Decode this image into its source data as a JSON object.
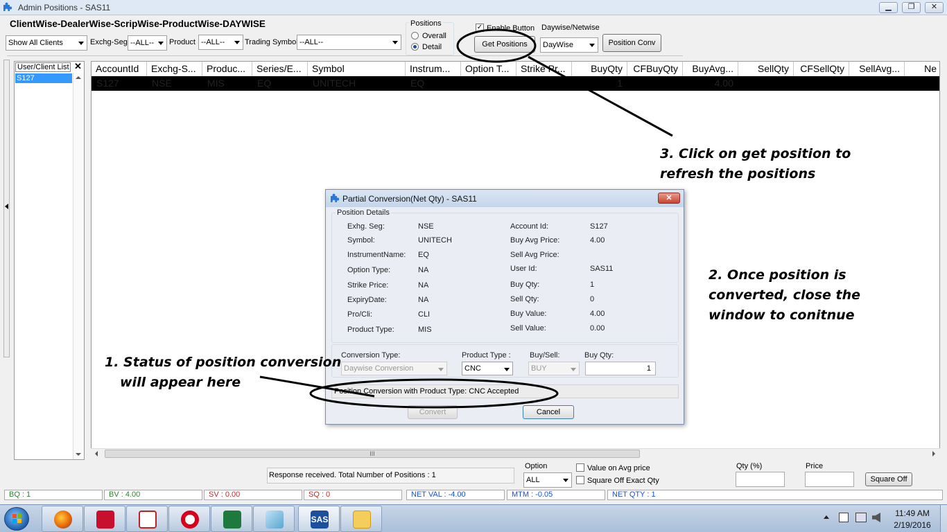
{
  "window": {
    "title": "Admin Positions - SAS11"
  },
  "heading": "ClientWise-DealerWise-ScripWise-ProductWise-DAYWISE",
  "filters": {
    "clients_value": "Show All Clients",
    "exchg_seg_label": "Exchg-Seg",
    "exchg_seg_value": "--ALL--",
    "product_label": "Product",
    "product_value": "--ALL--",
    "trading_symbol_label": "Trading Symbol",
    "trading_symbol_value": "--ALL--"
  },
  "positions_group": {
    "label": "Positions",
    "overall": "Overall",
    "detail": "Detail",
    "selected": "Detail"
  },
  "enable_button_label": "Enable Button",
  "get_positions_label": "Get Positions",
  "daywise_netwise": {
    "label": "Daywise/Netwise",
    "value": "DayWise"
  },
  "position_conv_label": "Position Conv",
  "user_list": {
    "header": "User/Client List",
    "items": [
      "S127"
    ]
  },
  "grid": {
    "columns": [
      "AccountId",
      "Exchg-S...",
      "Produc...",
      "Series/E...",
      "Symbol",
      "Instrum...",
      "Option T...",
      "Strike Pr...",
      "BuyQty",
      "CFBuyQty",
      "BuyAvg...",
      "SellQty",
      "CFSellQty",
      "SellAvg...",
      "Ne"
    ],
    "rows": [
      [
        "S127",
        "NSE",
        "MIS",
        "EQ",
        "UNITECH",
        "EQ",
        "",
        "",
        "1",
        "",
        "4.00",
        "",
        "",
        "",
        ""
      ]
    ]
  },
  "hscroll_grip": "III",
  "bottom": {
    "response": "Response received. Total Number of Positions : 1",
    "option_label": "Option",
    "option_value": "ALL",
    "value_on_avg_label": "Value on Avg  price",
    "square_off_exact_label": "Square Off Exact Qty",
    "qty_pct_label": "Qty (%)",
    "price_label": "Price",
    "square_off_button": "Square Off"
  },
  "status_bar": {
    "bq": "BQ : 1",
    "bv": "BV : 4.00",
    "sv": "SV : 0.00",
    "sq": "SQ : 0",
    "net_val": "NET VAL : -4.00",
    "mtm": "MTM : -0.05",
    "net_qty": "NET QTY : 1"
  },
  "dialog": {
    "title": "Partial Conversion(Net Qty) - SAS11",
    "group_label": "Position Details",
    "left_fields": [
      {
        "label": "Exhg. Seg:",
        "value": "NSE"
      },
      {
        "label": "Symbol:",
        "value": "UNITECH"
      },
      {
        "label": "InstrumentName:",
        "value": "EQ"
      },
      {
        "label": "Option Type:",
        "value": "NA"
      },
      {
        "label": "Strike Price:",
        "value": "NA"
      },
      {
        "label": "ExpiryDate:",
        "value": "NA"
      },
      {
        "label": "Pro/Cli:",
        "value": "CLI"
      },
      {
        "label": "Product Type:",
        "value": "MIS"
      }
    ],
    "right_fields": [
      {
        "label": "Account Id:",
        "value": "S127"
      },
      {
        "label": "Buy Avg Price:",
        "value": "4.00"
      },
      {
        "label": "Sell Avg Price:",
        "value": ""
      },
      {
        "label": "User Id:",
        "value": "SAS11"
      },
      {
        "label": "Buy Qty:",
        "value": "1"
      },
      {
        "label": "Sell Qty:",
        "value": "0"
      },
      {
        "label": "Buy Value:",
        "value": "4.00"
      },
      {
        "label": "Sell Value:",
        "value": "0.00"
      }
    ],
    "conversion_type_label": "Conversion Type:",
    "conversion_type_value": "Daywise Conversion",
    "product_type_label": "Product Type :",
    "product_type_value": "CNC",
    "buy_sell_label": "Buy/Sell:",
    "buy_sell_value": "BUY",
    "buy_qty_label": "Buy Qty:",
    "buy_qty_value": "1",
    "status_message": "Position Conversion with Product Type: CNC Accepted",
    "convert_button": "Convert",
    "cancel_button": "Cancel"
  },
  "annotations": {
    "a1_line1": "1. Status of position conversion",
    "a1_line2": "will appear here",
    "a2_line1": "2. Once position is",
    "a2_line2": "converted, close the",
    "a2_line3": "window to conitnue",
    "a3_line1": "3. Click on get position to",
    "a3_line2": "refresh the positions"
  },
  "taskbar": {
    "apps": [
      "windows-start",
      "firefox",
      "acrobat",
      "network-tool",
      "opera",
      "excel",
      "notes",
      "sas",
      "file-explorer"
    ],
    "sas_label": "SAS",
    "time": "11:49 AM",
    "date": "2/19/2016"
  },
  "colors": {
    "status_green": "#2e7d32",
    "status_red": "#c62828",
    "status_blue": "#1a4fd6",
    "selection": "#3399ff"
  }
}
